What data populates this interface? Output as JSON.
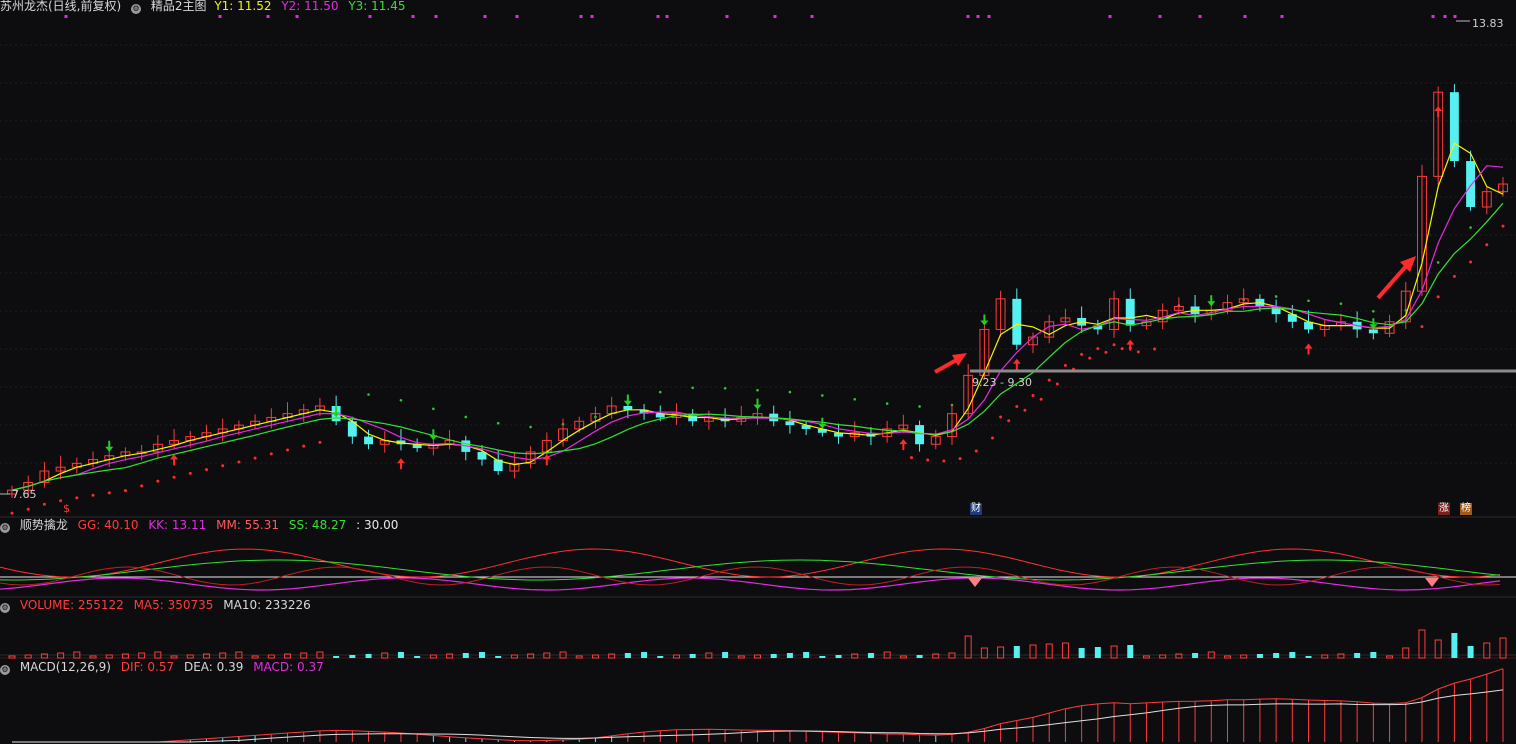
{
  "main_header": {
    "title": "苏州龙杰(日线,前复权)",
    "indicator": "精品2主图",
    "y1": "Y1: 11.52",
    "y2": "Y2: 11.50",
    "y3": "Y3: 11.45"
  },
  "price_labels": {
    "high": "13.83",
    "low": "7.65",
    "range": "9.23 - 9.30"
  },
  "event_tags": {
    "cai": "财",
    "zhang": "涨",
    "bang": "榜",
    "s_marker": "$"
  },
  "kdj_header": {
    "name": "顺势擒龙",
    "gg": "GG: 40.10",
    "kk": "KK: 13.11",
    "mm": "MM: 55.31",
    "ss": "SS: 48.27",
    "level": ": 30.00"
  },
  "vol_header": {
    "volume": "VOLUME: 255122",
    "ma5": "MA5: 350735",
    "ma10": "MA10: 233226"
  },
  "macd_header": {
    "name": "MACD(12,26,9)",
    "dif": "DIF: 0.57",
    "dea": "DEA: 0.39",
    "macd": "MACD: 0.37"
  },
  "colors": {
    "up": "#ff3b3b",
    "down": "#55f0f0",
    "y1": "#f5f500",
    "y2": "#e22ce2",
    "y3": "#33e033",
    "green_dots": "#2ec82e",
    "red_dots": "#ff2a2a"
  },
  "chart_data": {
    "type": "candlestick",
    "price_high": 13.83,
    "price_low": 7.65,
    "support_level": 9.23,
    "closes": [
      7.7,
      7.8,
      7.95,
      8.0,
      8.05,
      8.1,
      8.15,
      8.2,
      8.2,
      8.3,
      8.35,
      8.4,
      8.45,
      8.5,
      8.55,
      8.6,
      8.65,
      8.7,
      8.75,
      8.8,
      8.6,
      8.4,
      8.3,
      8.35,
      8.3,
      8.25,
      8.3,
      8.35,
      8.2,
      8.1,
      7.95,
      8.05,
      8.2,
      8.35,
      8.5,
      8.6,
      8.7,
      8.8,
      8.75,
      8.7,
      8.65,
      8.7,
      8.6,
      8.65,
      8.6,
      8.65,
      8.7,
      8.6,
      8.55,
      8.5,
      8.45,
      8.4,
      8.45,
      8.4,
      8.5,
      8.55,
      8.3,
      8.4,
      8.7,
      9.2,
      9.8,
      10.2,
      9.6,
      9.7,
      9.9,
      9.95,
      9.85,
      9.8,
      10.2,
      9.85,
      9.9,
      10.05,
      10.1,
      10.0,
      10.05,
      10.15,
      10.2,
      10.1,
      10.0,
      9.9,
      9.8,
      9.85,
      9.9,
      9.8,
      9.75,
      9.9,
      10.3,
      11.8,
      12.9,
      12.0,
      11.4,
      11.6,
      11.7
    ]
  }
}
